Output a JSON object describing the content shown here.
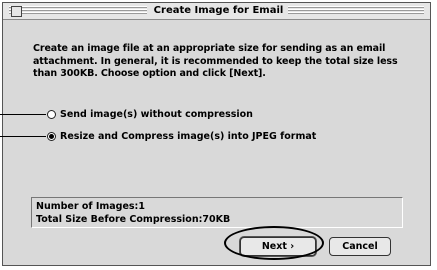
{
  "window": {
    "title": "Create Image for Email"
  },
  "description": {
    "line1": "Create an image file at an appropriate size for sending as an email",
    "line2": "attachment. In general, it is recommended to  keep the total size less",
    "line3": "than 300KB. Choose option and click [Next]."
  },
  "options": [
    {
      "label": "Send image(s) without compression",
      "selected": false
    },
    {
      "label": "Resize and Compress image(s) into JPEG format",
      "selected": true
    }
  ],
  "info": {
    "line1": "Number of Images:1",
    "line2": "Total Size Before Compression:70KB"
  },
  "buttons": {
    "next_label": "Next ›",
    "cancel_label": "Cancel"
  },
  "icons": {
    "close": "close-box-icon",
    "radio_off": "radio-unselected-icon",
    "radio_on": "radio-selected-icon"
  }
}
